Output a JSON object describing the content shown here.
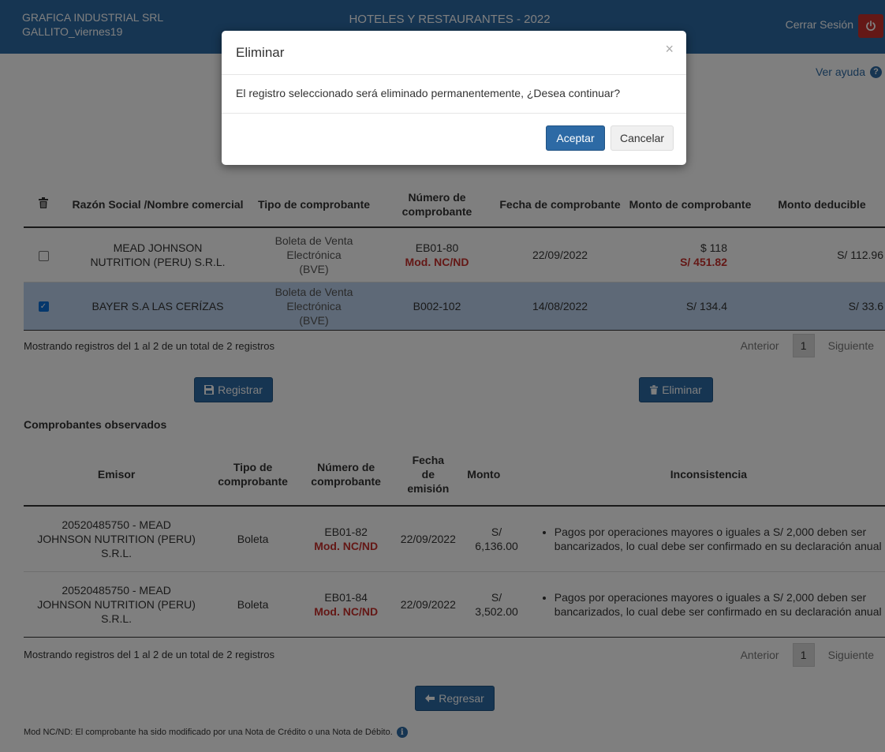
{
  "header": {
    "company": "GRAFICA INDUSTRIAL SRL",
    "user": "GALLITO_viernes19",
    "title": "HOTELES Y RESTAURANTES - 2022",
    "logout_label": "Cerrar Sesión"
  },
  "help_label": "Ver ayuda",
  "table1": {
    "headers": {
      "razon": "Razón Social /Nombre comercial",
      "tipo": "Tipo de comprobante",
      "numero": "Número de comprobante",
      "fecha": "Fecha de comprobante",
      "monto": "Monto de comprobante",
      "deducible": "Monto deducible"
    },
    "rows": [
      {
        "checked": false,
        "razon": "MEAD JOHNSON NUTRITION (PERU) S.R.L.",
        "tipo": "Boleta de Venta Electrónica (BVE)",
        "numero": "EB01-80",
        "mod": "Mod. NC/ND",
        "fecha": "22/09/2022",
        "monto": "$ 118",
        "monto_mod": "S/ 451.82",
        "deducible": "S/ 112.96"
      },
      {
        "checked": true,
        "razon": "BAYER S.A LAS CERÍZAS",
        "tipo": "Boleta de Venta Electrónica (BVE)",
        "numero": "B002-102",
        "mod": "",
        "fecha": "14/08/2022",
        "monto": "S/ 134.4",
        "monto_mod": "",
        "deducible": "S/ 33.6"
      }
    ],
    "info": "Mostrando registros del 1 al 2 de un total de 2 registros",
    "pager": {
      "prev": "Anterior",
      "page": "1",
      "next": "Siguiente"
    }
  },
  "buttons": {
    "registrar": "Registrar",
    "eliminar": "Eliminar",
    "regresar": "Regresar"
  },
  "observados": {
    "title": "Comprobantes observados",
    "headers": {
      "emisor": "Emisor",
      "tipo": "Tipo de comprobante",
      "numero": "Número de comprobante",
      "fecha": "Fecha de emisión",
      "monto": "Monto",
      "incons": "Inconsistencia"
    },
    "rows": [
      {
        "emisor": "20520485750 - MEAD JOHNSON NUTRITION (PERU) S.R.L.",
        "tipo": "Boleta",
        "numero": "EB01-82",
        "mod": "Mod. NC/ND",
        "fecha": "22/09/2022",
        "monto": "S/ 6,136.00",
        "incons": "Pagos por operaciones mayores o iguales a S/ 2,000 deben ser bancarizados, lo cual debe ser confirmado en su declaración anual"
      },
      {
        "emisor": "20520485750 - MEAD JOHNSON NUTRITION (PERU) S.R.L.",
        "tipo": "Boleta",
        "numero": "EB01-84",
        "mod": "Mod. NC/ND",
        "fecha": "22/09/2022",
        "monto": "S/ 3,502.00",
        "incons": "Pagos por operaciones mayores o iguales a S/ 2,000 deben ser bancarizados, lo cual debe ser confirmado en su declaración anual"
      }
    ],
    "info": "Mostrando registros del 1 al 2 de un total de 2 registros",
    "pager": {
      "prev": "Anterior",
      "page": "1",
      "next": "Siguiente"
    }
  },
  "footnote": "Mod NC/ND: El comprobante ha sido modificado por una Nota de Crédito o una Nota de Débito.",
  "modal": {
    "title": "Eliminar",
    "close": "×",
    "body": "El registro seleccionado será eliminado permanentemente, ¿Desea continuar?",
    "ok": "Aceptar",
    "cancel": "Cancelar"
  }
}
